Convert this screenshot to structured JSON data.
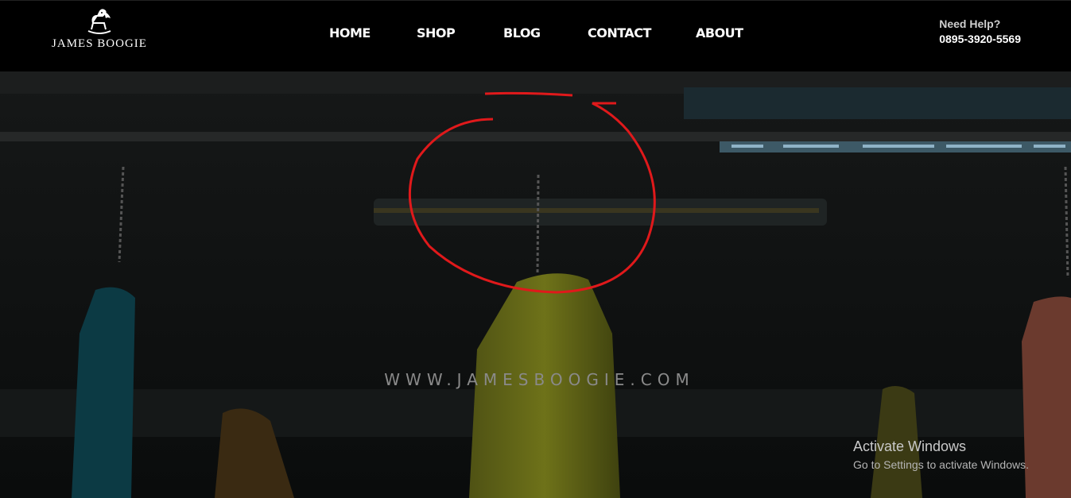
{
  "brand": {
    "name": "JAMES BOOGIE",
    "logo_icon": "rocking-horse-icon"
  },
  "nav": {
    "items": [
      "HOME",
      "SHOP",
      "BLOG",
      "CONTACT",
      "ABOUT"
    ]
  },
  "help": {
    "label": "Need Help?",
    "phone": "0895-3920-5569"
  },
  "hero": {
    "watermark": "WWW.JAMESBOOGIE.COM"
  },
  "os_notice": {
    "title": "Activate Windows",
    "subtitle": "Go to Settings to activate Windows."
  },
  "colors": {
    "annotation": "#e0191b",
    "header_bg": "#000000"
  }
}
